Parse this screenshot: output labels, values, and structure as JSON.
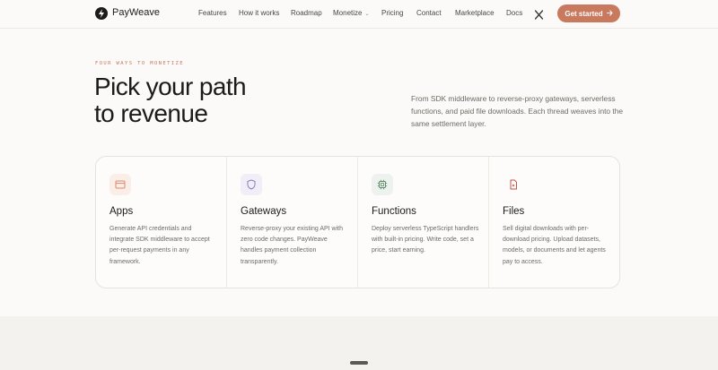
{
  "brand": {
    "name": "PayWeave",
    "logo_icon": "bolt-icon"
  },
  "nav": {
    "links": [
      {
        "label": "Features"
      },
      {
        "label": "How it works"
      },
      {
        "label": "Roadmap"
      },
      {
        "label": "Monetize",
        "has_dropdown": true
      },
      {
        "label": "Pricing"
      },
      {
        "label": "Contact"
      },
      {
        "label": "Marketplace"
      },
      {
        "label": "Docs"
      }
    ],
    "social_icon": "x-icon",
    "cta_label": "Get started",
    "cta_icon": "arrow-right-icon"
  },
  "hero": {
    "eyebrow": "FOUR WAYS TO MONETIZE",
    "headline_line1": "Pick your path",
    "headline_line2": "to revenue",
    "intro": "From SDK middleware to reverse-proxy gateways, serverless functions, and paid file downloads. Each thread weaves into the same settlement layer."
  },
  "cards": [
    {
      "title": "Apps",
      "icon": "window-icon",
      "description": "Generate API credentials and integrate SDK middleware to accept per-request payments in any framework."
    },
    {
      "title": "Gateways",
      "icon": "shield-icon",
      "description": "Reverse-proxy your existing API with zero code changes. PayWeave handles payment collection transparently."
    },
    {
      "title": "Functions",
      "icon": "chip-icon",
      "description": "Deploy serverless TypeScript handlers with built-in pricing. Write code, set a price, start earning."
    },
    {
      "title": "Files",
      "icon": "file-icon",
      "description": "Sell digital downloads with per-download pricing. Upload datasets, models, or documents and let agents pay to access."
    }
  ],
  "colors": {
    "accent": "#c97a5e",
    "eyebrow": "#c47a62",
    "apps_icon_bg": "#fbeee8",
    "gateways_icon_bg": "#f1eef8",
    "functions_icon_bg": "#eef2ee",
    "files_icon_bg": "#fdfcfb"
  }
}
